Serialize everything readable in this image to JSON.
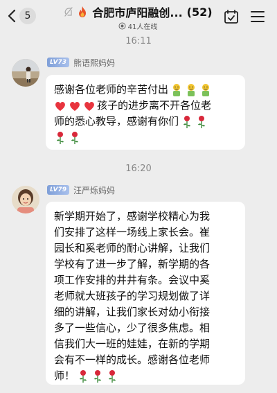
{
  "header": {
    "back_count": "5",
    "group_title": "合肥市庐阳融创...",
    "member_count": "(52)",
    "online": "41人在线",
    "icons": [
      "chevron-left-icon",
      "mute-icon",
      "fire-icon",
      "calendar-check-icon",
      "menu-icon"
    ]
  },
  "messages": [
    {
      "time": "16:11",
      "level": "LV73",
      "sender": "熊语熙妈妈",
      "lines": [
        "感谢各位老师的辛苦付出",
        "孩子的进步离不开各位老",
        "师的悉心教导，感谢有你们",
        ""
      ]
    },
    {
      "time": "16:20",
      "level": "LV79",
      "sender": "汪严烁妈妈",
      "lines": [
        "新学期开始了，感谢学校精心为我",
        "们安排了这样一场线上家长会。崔",
        "园长和奚老师的耐心讲解，让我们",
        "学校有了进一步了解，新学期的各",
        "项工作安排的井井有条。会议中奚",
        "老师就大班孩子的学习规划做了详",
        "细的讲解，让我们家长对幼小衔接",
        "多了一些信心，少了很多焦虑。相",
        "信我们大一班的娃娃，在新的学期",
        "会有不一样的成长。感谢各位老师",
        "师！"
      ]
    }
  ]
}
